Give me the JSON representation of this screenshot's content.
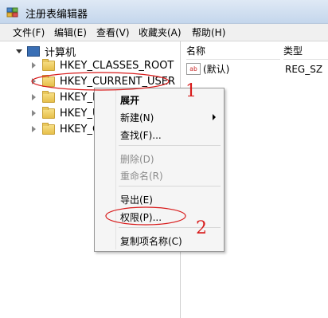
{
  "window": {
    "title": "注册表编辑器"
  },
  "menubar": [
    "文件(F)",
    "编辑(E)",
    "查看(V)",
    "收藏夹(A)",
    "帮助(H)"
  ],
  "tree": {
    "root": "计算机",
    "items": [
      "HKEY_CLASSES_ROOT",
      "HKEY_CURRENT_USER",
      "HKEY_L",
      "HKEY_U",
      "HKEY_C"
    ]
  },
  "list": {
    "columns": [
      "名称",
      "类型"
    ],
    "rows": [
      {
        "icon": "ab",
        "name": "(默认)",
        "type": "REG_SZ"
      }
    ]
  },
  "context_menu": {
    "items": [
      "展开",
      "新建(N)",
      "查找(F)...",
      "删除(D)",
      "重命名(R)",
      "导出(E)",
      "权限(P)...",
      "复制项名称(C)"
    ]
  },
  "annotations": [
    "1",
    "2"
  ],
  "colors": {
    "annotation": "#d81b1b",
    "titlebar": "#c4d6ec"
  }
}
